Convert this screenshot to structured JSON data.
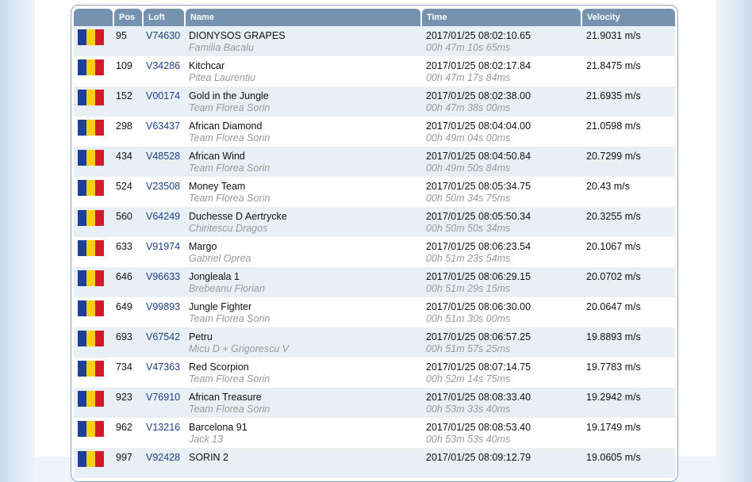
{
  "table": {
    "headers": {
      "flag": "",
      "pos": "Pos",
      "loft": "Loft",
      "name": "Name",
      "time": "Time",
      "velocity": "Velocity"
    },
    "flag_colors": {
      "blue": "#1c3f9c",
      "yellow": "#f6d20e",
      "red": "#d21a28"
    },
    "header_color": "#7592b1",
    "rows": [
      {
        "pos": "95",
        "loft": "V74630",
        "name": "DIONYSOS GRAPES",
        "owner": "Familia Bacalu",
        "time": "2017/01/25 08:02:10.65",
        "duration": "00h 47m 10s 65ms",
        "velocity": "21.9031 m/s"
      },
      {
        "pos": "109",
        "loft": "V34286",
        "name": "Kitchcar",
        "owner": "Pitea Laurentiu",
        "time": "2017/01/25 08:02:17.84",
        "duration": "00h 47m 17s 84ms",
        "velocity": "21.8475 m/s"
      },
      {
        "pos": "152",
        "loft": "V00174",
        "name": "Gold in the Jungle",
        "owner": "Team Florea Sorin",
        "time": "2017/01/25 08:02:38.00",
        "duration": "00h 47m 38s 00ms",
        "velocity": "21.6935 m/s"
      },
      {
        "pos": "298",
        "loft": "V63437",
        "name": "African Diamond",
        "owner": "Team Florea Sorin",
        "time": "2017/01/25 08:04:04.00",
        "duration": "00h 49m 04s 00ms",
        "velocity": "21.0598 m/s"
      },
      {
        "pos": "434",
        "loft": "V48528",
        "name": "African Wind",
        "owner": "Team Florea Sorin",
        "time": "2017/01/25 08:04:50.84",
        "duration": "00h 49m 50s 84ms",
        "velocity": "20.7299 m/s"
      },
      {
        "pos": "524",
        "loft": "V23508",
        "name": "Money Team",
        "owner": "Team Florea Sorin",
        "time": "2017/01/25 08:05:34.75",
        "duration": "00h 50m 34s 75ms",
        "velocity": "20.43 m/s"
      },
      {
        "pos": "560",
        "loft": "V64249",
        "name": "Duchesse D Aertrycke",
        "owner": "Chiritescu Dragos",
        "time": "2017/01/25 08:05:50.34",
        "duration": "00h 50m 50s 34ms",
        "velocity": "20.3255 m/s"
      },
      {
        "pos": "633",
        "loft": "V91974",
        "name": "Margo",
        "owner": "Gabriel Oprea",
        "time": "2017/01/25 08:06:23.54",
        "duration": "00h 51m 23s 54ms",
        "velocity": "20.1067 m/s"
      },
      {
        "pos": "646",
        "loft": "V96633",
        "name": "Jongleala 1",
        "owner": "Brebeanu Florian",
        "time": "2017/01/25 08:06:29.15",
        "duration": "00h 51m 29s 15ms",
        "velocity": "20.0702 m/s"
      },
      {
        "pos": "649",
        "loft": "V99893",
        "name": "Jungle Fighter",
        "owner": "Team Florea Sorin",
        "time": "2017/01/25 08:06:30.00",
        "duration": "00h 51m 30s 00ms",
        "velocity": "20.0647 m/s"
      },
      {
        "pos": "693",
        "loft": "V67542",
        "name": "Petru",
        "owner": "Micu D + Grigorescu V",
        "time": "2017/01/25 08:06:57.25",
        "duration": "00h 51m 57s 25ms",
        "velocity": "19.8893 m/s"
      },
      {
        "pos": "734",
        "loft": "V47363",
        "name": "Red Scorpion",
        "owner": "Team Florea Sorin",
        "time": "2017/01/25 08:07:14.75",
        "duration": "00h 52m 14s 75ms",
        "velocity": "19.7783 m/s"
      },
      {
        "pos": "923",
        "loft": "V76910",
        "name": "African Treasure",
        "owner": "Team Florea Sorin",
        "time": "2017/01/25 08:08:33.40",
        "duration": "00h 53m 33s 40ms",
        "velocity": "19.2942 m/s"
      },
      {
        "pos": "962",
        "loft": "V13216",
        "name": "Barcelona 91",
        "owner": "Jack 13",
        "time": "2017/01/25 08:08:53.40",
        "duration": "00h 53m 53s 40ms",
        "velocity": "19.1749 m/s"
      },
      {
        "pos": "997",
        "loft": "V92428",
        "name": "SORIN 2",
        "owner": "",
        "time": "2017/01/25 08:09:12.79",
        "duration": "",
        "velocity": "19.0605 m/s"
      }
    ]
  }
}
